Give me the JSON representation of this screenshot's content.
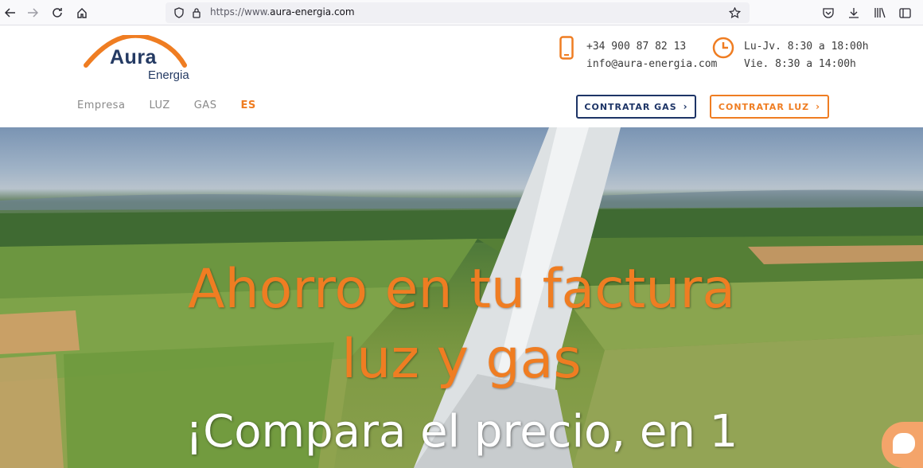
{
  "browser": {
    "url_prefix": "https://www.",
    "url_host": "aura-energia.com"
  },
  "logo": {
    "line1": "Aura",
    "line2": "Energia"
  },
  "contact": {
    "phone": "+34 900 87 82 13",
    "email": "info@aura-energia.com",
    "hours_weekdays": "Lu-Jv. 8:30 a 18:00h",
    "hours_friday": "Vie. 8:30 a 14:00h"
  },
  "nav": {
    "items": [
      {
        "label": "Empresa"
      },
      {
        "label": "LUZ"
      },
      {
        "label": "GAS"
      },
      {
        "label": "ES"
      }
    ]
  },
  "buttons": {
    "gas_label": "CONTRATAR GAS",
    "luz_label": "CONTRATAR LUZ"
  },
  "hero": {
    "title_line1": "Ahorro en tu factura",
    "title_line2": "luz y gas",
    "subtitle": "¡Compara el precio, en 1"
  },
  "colors": {
    "brand_orange": "#ef7d22",
    "brand_navy": "#1d3466"
  },
  "icons": {
    "back": "arrow-left-icon",
    "forward": "arrow-right-icon",
    "reload": "reload-icon",
    "home": "home-icon",
    "shield": "shield-icon",
    "lock": "lock-icon",
    "star": "star-icon",
    "pocket": "pocket-icon",
    "download": "download-icon",
    "library": "library-icon",
    "sidebar": "sidebar-icon",
    "phone": "phone-icon",
    "clock": "clock-icon",
    "chat": "chat-icon"
  }
}
